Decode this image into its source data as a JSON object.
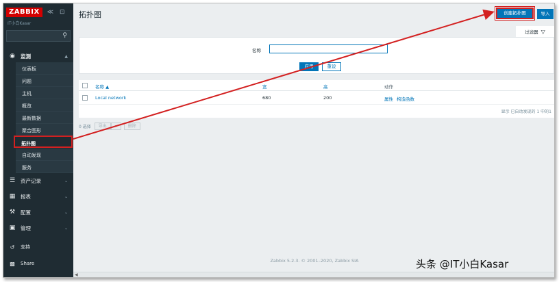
{
  "sidebar": {
    "logo": "ZABBIX",
    "collapse_controls": "≪ ⊡",
    "server_name": "IT小白Kasar",
    "search_placeholder": "",
    "monitoring": {
      "label": "监测",
      "items": [
        "仪表板",
        "问题",
        "主机",
        "概览",
        "最新数据",
        "聚合图形",
        "拓扑图",
        "自动发现",
        "服务"
      ],
      "active": "拓扑图"
    },
    "sections": [
      {
        "label": "资产记录",
        "icon": "list-icon"
      },
      {
        "label": "报表",
        "icon": "report-icon"
      },
      {
        "label": "配置",
        "icon": "wrench-icon"
      },
      {
        "label": "管理",
        "icon": "admin-icon"
      }
    ],
    "bottom": [
      {
        "label": "支持",
        "icon": "support-icon"
      },
      {
        "label": "Share",
        "icon": "share-icon"
      }
    ]
  },
  "header": {
    "title": "拓扑图",
    "create_button": "创建拓扑图",
    "import_button": "导入"
  },
  "filter": {
    "tab_label": "过滤器",
    "name_label": "名称",
    "name_value": "",
    "apply": "应用",
    "reset": "重设"
  },
  "table": {
    "columns": {
      "name": "名称 ▲",
      "width": "宽",
      "height": "高",
      "actions": "动作"
    },
    "rows": [
      {
        "name": "Local network",
        "width": "680",
        "height": "200",
        "properties": "属性",
        "constructor": "构造函数"
      }
    ],
    "footer": "显示 已自动发现的 1 中的1"
  },
  "mass_actions": {
    "selected": "0 选择",
    "export": "导出",
    "export_arrow": "▾",
    "delete": "删除"
  },
  "footer": "Zabbix 5.2.3. © 2001–2020, Zabbix SIA",
  "watermark": "头条 @IT小白Kasar",
  "colors": {
    "sidebar_bg": "#1f2c33",
    "accent_blue": "#0275b8",
    "logo_red": "#d40000",
    "annotation_red": "#d32020"
  }
}
